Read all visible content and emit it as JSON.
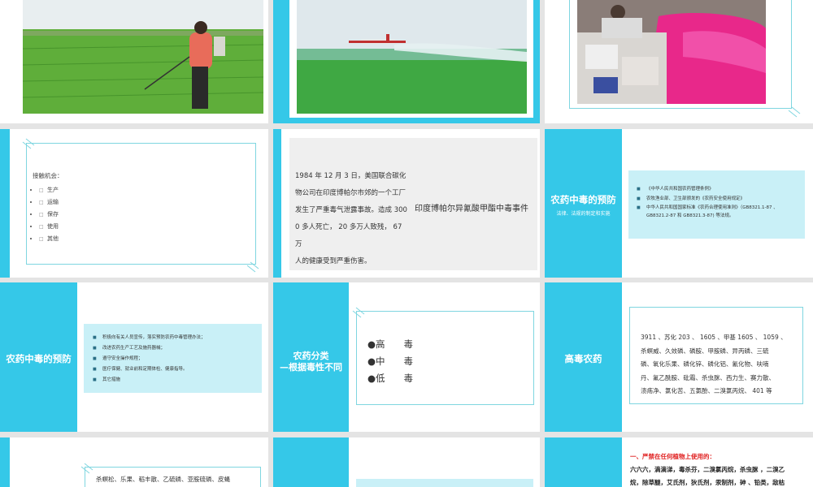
{
  "row1": {
    "slide1": {
      "photo": "farmer-spraying-field-photo"
    },
    "slide2": {
      "photo": "crop-duster-plane-photo"
    },
    "slide3": {
      "photo": "pesticide-bags-pink-powder-photo"
    }
  },
  "row2": {
    "contact": {
      "heading": "接触机会：",
      "items": [
        "生产",
        "运输",
        "保存",
        "使用",
        "其他"
      ]
    },
    "bhopal": {
      "body": "1984 年 12 月 3 日，美国联合碳化物公司在印度博帕尔市郊的一个工厂发生了严重毒气泄露事故。造成 3000 多人死亡， 20 多万人致残， 67 万人的健康受到严重伤害。",
      "lines": [
        "1984 年 12 月 3 日，美国联合碳化",
        "物公司在印度博帕尔市郊的一个工厂",
        "发生了严重毒气泄露事故。造成 300",
        "0 多人死亡， 20 多万人致残， 67 万",
        "人的健康受到严重伤害。"
      ],
      "title": "印度博帕尔异氰酸甲酯中毒事件"
    },
    "laws": {
      "title": "农药中毒的预防",
      "subtitle": "法律、法规的制定和实施",
      "items": [
        "《中华人民共和国农药管理条例》",
        "农牧渔业部、卫生部颁发的《农药安全使用规定》",
        "中华人民共和国国家标准《农药合理使用准则》（GB8321.1-87 、GB8321.2-87 和 GB8321.3-87) 等法规。"
      ]
    }
  },
  "row3": {
    "prevent": {
      "title": "农药中毒的预防",
      "items": [
        "积极向有关人员宣传，落实预防农药中毒管理办法；",
        "改进农药生产工艺及施药器械；",
        "遵守安全操作规程；",
        "医疗保健、就业前和定期体检、健康指导。",
        "其它措施"
      ]
    },
    "classify": {
      "title_line1": "农药分类",
      "title_line2": "—根据毒性不同",
      "items": [
        "●高　　毒",
        "●中　　毒",
        "●低　　毒"
      ]
    },
    "high": {
      "title": "高毒农药",
      "lines": [
        "3911 、苏化 203 、 1605 、甲基 1605 、 1059 、",
        "杀螟威、久效磷、磷胺、甲胺磷、异丙磷、三硫",
        "磷、氧化乐果、磷化锌、磷化铝、氰化物、呋喃",
        "丹、氟乙酰胺、砒霜、杀虫脒、西力生、赛力散、",
        "溃疡净、氯化苦、五氯酚、二溴氯丙烷、 401 等"
      ]
    }
  },
  "row4": {
    "moderate": {
      "line": "杀螟松、乐果、稻丰散、乙硫磷、亚胺硫磷、皮蝇"
    },
    "banned": {
      "heading": "一、严禁在任何植物上使用的：",
      "line1": "六六六，滴滴涕，毒杀芬，二溴氯丙烷，杀虫脒 ，二溴乙",
      "line2": "烷，除草醚，艾氏剂，狄氏剂，汞制剂，砷 、铅类，敌枯"
    }
  },
  "colors": {
    "cyan": "#35c8e8",
    "light": "#c9f0f7",
    "frame": "#7fd6e0",
    "red": "#e02020"
  }
}
